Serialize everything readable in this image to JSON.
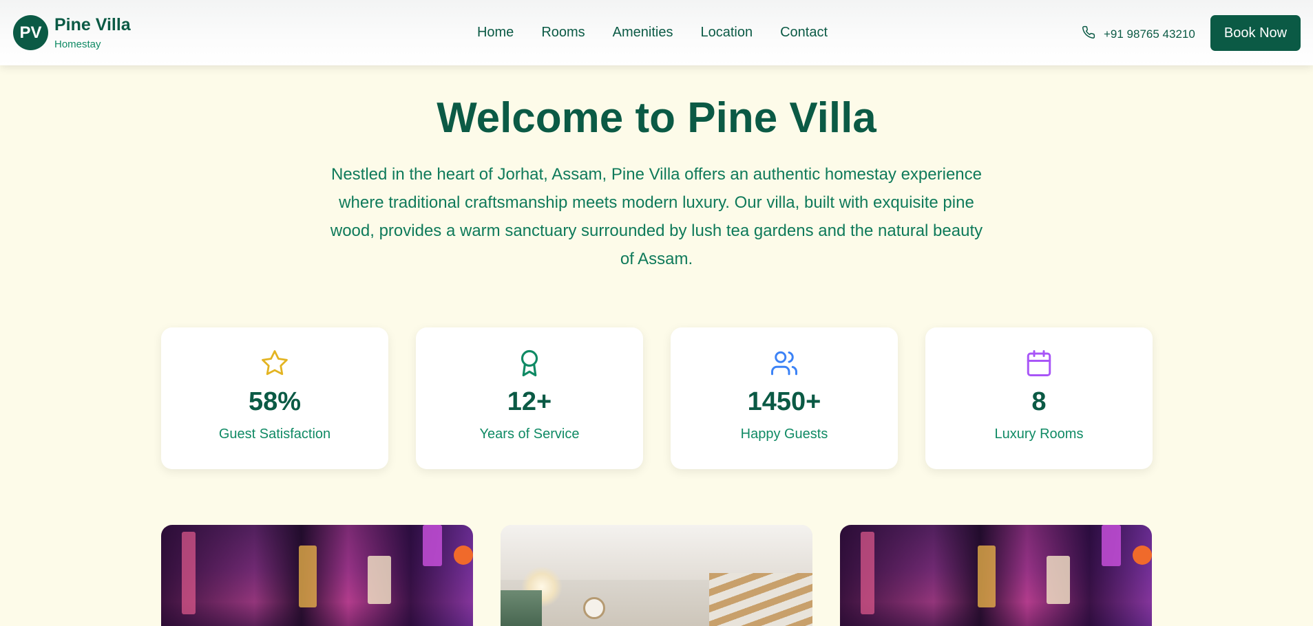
{
  "brand": {
    "initials": "PV",
    "name": "Pine Villa",
    "subtitle": "Homestay"
  },
  "nav": {
    "items": [
      "Home",
      "Rooms",
      "Amenities",
      "Location",
      "Contact"
    ]
  },
  "contact": {
    "phone": "+91 98765 43210"
  },
  "header": {
    "cta_label": "Book Now"
  },
  "hero": {
    "title": "Welcome to Pine Villa",
    "description": "Nestled in the heart of Jorhat, Assam, Pine Villa offers an authentic homestay experience where traditional craftsmanship meets modern luxury. Our villa, built with exquisite pine wood, provides a warm sanctuary surrounded by lush tea gardens and the natural beauty of Assam."
  },
  "stats": [
    {
      "icon": "star-icon",
      "color": "#e3b422",
      "value": "58%",
      "label": "Guest Satisfaction"
    },
    {
      "icon": "award-icon",
      "color": "#0f8a64",
      "value": "12+",
      "label": "Years of Service"
    },
    {
      "icon": "users-icon",
      "color": "#3b82f6",
      "value": "1450+",
      "label": "Happy Guests"
    },
    {
      "icon": "calendar-icon",
      "color": "#a855f7",
      "value": "8",
      "label": "Luxury Rooms"
    }
  ],
  "gallery": [
    {
      "name": "neon-street-photo"
    },
    {
      "name": "villa-interior-photo"
    },
    {
      "name": "neon-street-photo"
    }
  ],
  "colors": {
    "primary": "#0b5a45",
    "accent": "#0f8a64",
    "background": "#fdfbe9"
  }
}
